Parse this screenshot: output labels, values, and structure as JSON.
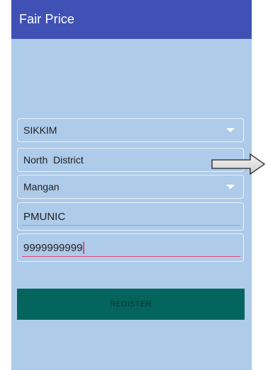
{
  "app": {
    "title": "Fair Price"
  },
  "form": {
    "state": {
      "value": "SIKKIM"
    },
    "district": {
      "value": "North  District"
    },
    "subdivision": {
      "value": "Mangan"
    },
    "name": {
      "value": "PMUNIC"
    },
    "phone": {
      "value": "9999999999"
    },
    "register_label": "REGISTER"
  },
  "colors": {
    "appbar": "#3f51b5",
    "background": "#aecbe9",
    "button": "#03655e",
    "focus_underline": "#e0457b"
  },
  "icons": {
    "dropdown": "chevron-down-icon",
    "annotation": "arrow-right-icon"
  }
}
